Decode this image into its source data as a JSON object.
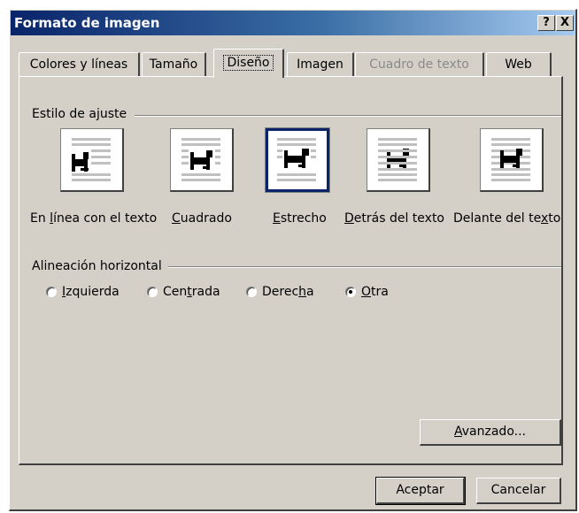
{
  "window": {
    "title": "Formato de imagen",
    "help_label": "?",
    "close_label": "X"
  },
  "tabs": [
    {
      "label": "Colores y líneas",
      "state": "normal"
    },
    {
      "label": "Tamaño",
      "state": "normal"
    },
    {
      "label": "Diseño",
      "state": "active"
    },
    {
      "label": "Imagen",
      "state": "normal"
    },
    {
      "label": "Cuadro de texto",
      "state": "disabled"
    },
    {
      "label": "Web",
      "state": "normal"
    }
  ],
  "wrap_style": {
    "group_label": "Estilo de ajuste",
    "options": [
      {
        "pre": "En ",
        "key": "l",
        "post": "ínea con el texto",
        "icon": "inline-with-text-icon"
      },
      {
        "pre": "",
        "key": "C",
        "post": "uadrado",
        "icon": "square-wrap-icon"
      },
      {
        "pre": "",
        "key": "E",
        "post": "strecho",
        "icon": "tight-wrap-icon",
        "selected": true
      },
      {
        "pre": "",
        "key": "D",
        "post": "etrás del texto",
        "icon": "behind-text-icon"
      },
      {
        "pre": "Delante del te",
        "key": "x",
        "post": "to",
        "icon": "in-front-of-text-icon"
      }
    ]
  },
  "horizontal_alignment": {
    "group_label": "Alineación horizontal",
    "options": [
      {
        "pre": "",
        "key": "I",
        "post": "zquierda",
        "checked": false
      },
      {
        "pre": "Cen",
        "key": "t",
        "post": "rada",
        "checked": false
      },
      {
        "pre": "Derec",
        "key": "h",
        "post": "a",
        "checked": false
      },
      {
        "pre": "",
        "key": "O",
        "post": "tra",
        "checked": true
      }
    ]
  },
  "buttons": {
    "advanced": {
      "key": "A",
      "post": "vanzado..."
    },
    "ok": "Aceptar",
    "cancel": "Cancelar"
  },
  "colors": {
    "dialog_bg": "#d4d0c8",
    "title_start": "#0a246a",
    "title_end": "#a6caf0",
    "selected_border": "#0a246a",
    "disabled_text": "#8a8a8a"
  }
}
